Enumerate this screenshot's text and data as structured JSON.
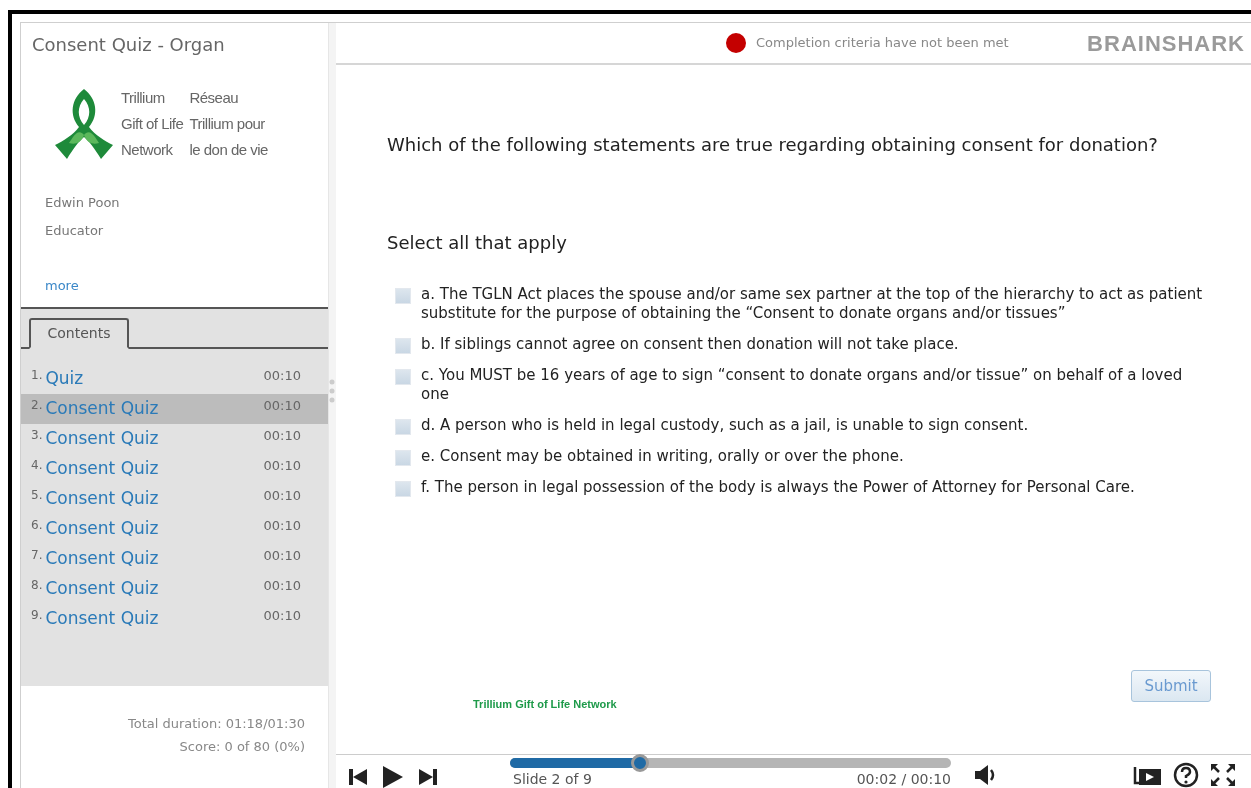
{
  "course_title": "Consent Quiz - Organ",
  "logo": {
    "english": [
      "Trillium",
      "Gift of Life",
      "Network"
    ],
    "french": [
      "Réseau",
      "Trillium pour",
      "le don de vie"
    ]
  },
  "presenter": {
    "name": "Edwin Poon",
    "role": "Educator",
    "more_link": "more"
  },
  "contents_tab": {
    "label": "Contents",
    "selected": true
  },
  "contents": [
    {
      "number": "1.",
      "title": "Quiz",
      "duration": "00:10",
      "selected": false
    },
    {
      "number": "2.",
      "title": "Consent Quiz",
      "duration": "00:10",
      "selected": true
    },
    {
      "number": "3.",
      "title": "Consent Quiz",
      "duration": "00:10",
      "selected": false
    },
    {
      "number": "4.",
      "title": "Consent Quiz",
      "duration": "00:10",
      "selected": false
    },
    {
      "number": "5.",
      "title": "Consent Quiz",
      "duration": "00:10",
      "selected": false
    },
    {
      "number": "6.",
      "title": "Consent Quiz",
      "duration": "00:10",
      "selected": false
    },
    {
      "number": "7.",
      "title": "Consent Quiz",
      "duration": "00:10",
      "selected": false
    },
    {
      "number": "8.",
      "title": "Consent Quiz",
      "duration": "00:10",
      "selected": false
    },
    {
      "number": "9.",
      "title": "Consent Quiz",
      "duration": "00:10",
      "selected": false
    }
  ],
  "total_duration": "Total duration: 01:18/01:30",
  "score": "Score: 0 of 80 (0%)",
  "status": {
    "text": "Completion criteria have not been met",
    "completed": false
  },
  "brand": "BRAINSHARK",
  "question": "Which of the following statements are true regarding obtaining consent for donation?",
  "instruction": "Select all that apply",
  "options": [
    {
      "text": "a. The TGLN Act places the spouse and/or same sex partner at the top of the hierarchy to act as patient substitute for the purpose of obtaining the “Consent to donate organs and/or tissues”",
      "checked": false
    },
    {
      "text": "b. If siblings cannot agree on consent then donation will not take place.",
      "checked": false
    },
    {
      "text": "c. You MUST be 16 years of age to sign “consent to donate organs and/or tissue” on behalf of a loved one",
      "checked": false
    },
    {
      "text": "d. A person who is held in legal custody, such as a jail, is unable to sign consent.",
      "checked": false
    },
    {
      "text": "e. Consent may be obtained in writing, orally or over the phone.",
      "checked": false
    },
    {
      "text": "f. The person in legal possession of the body is always the Power of Attorney for Personal Care.",
      "checked": false
    }
  ],
  "submit": "Submit",
  "footer_logo": "Trillium Gift of Life Network",
  "player": {
    "progress": {
      "level": 0.295
    },
    "slide": "Slide 2 of 9",
    "time": "00:02 / 00:10"
  }
}
